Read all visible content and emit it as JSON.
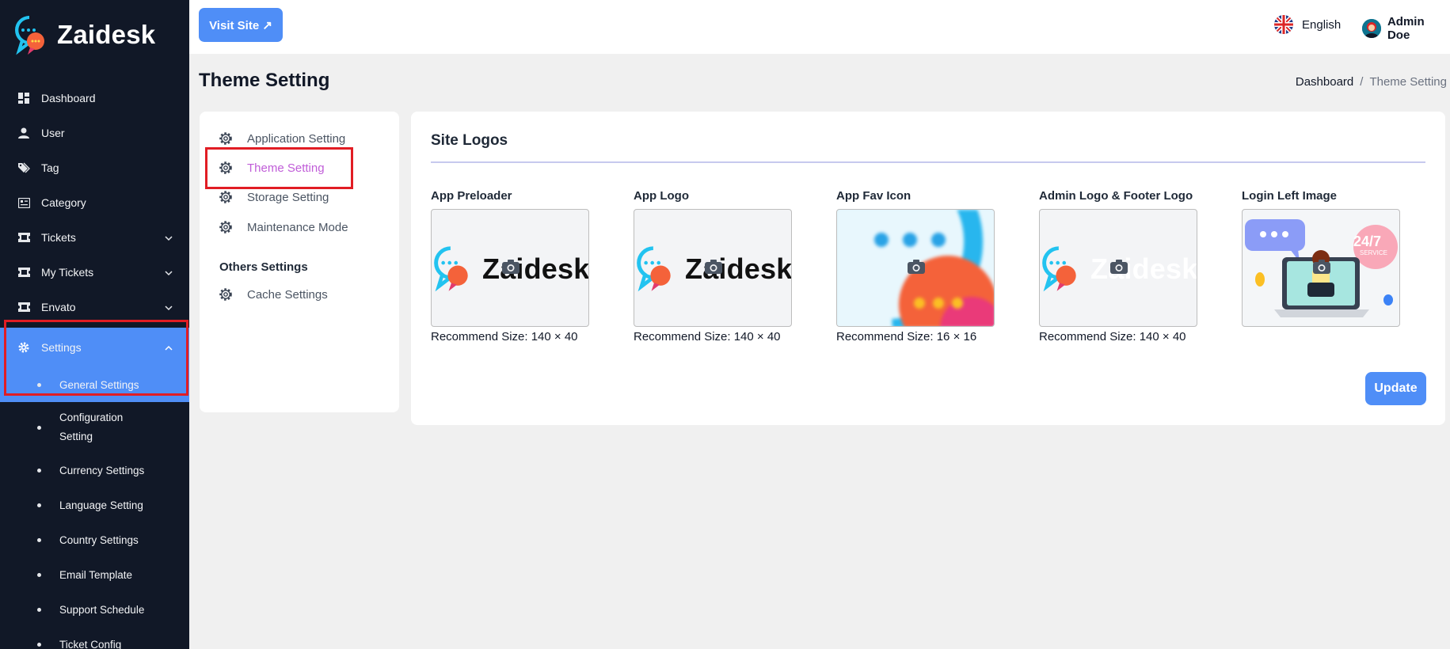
{
  "brand": {
    "name": "Zaidesk"
  },
  "sidebar": {
    "items": [
      {
        "label": "Dashboard",
        "icon": "dashboard-icon"
      },
      {
        "label": "User",
        "icon": "user-icon"
      },
      {
        "label": "Tag",
        "icon": "tag-icon"
      },
      {
        "label": "Category",
        "icon": "category-icon"
      },
      {
        "label": "Tickets",
        "icon": "ticket-icon",
        "has_chevron": true
      },
      {
        "label": "My Tickets",
        "icon": "ticket-icon",
        "has_chevron": true
      },
      {
        "label": "Envato",
        "icon": "ticket-icon",
        "has_chevron": true
      },
      {
        "label": "Settings",
        "icon": "gear-icon",
        "expanded": true
      }
    ],
    "subitems": [
      {
        "label": "General Settings"
      },
      {
        "label": "Configuration Setting"
      },
      {
        "label": "Currency Settings"
      },
      {
        "label": "Language Setting"
      },
      {
        "label": "Country Settings"
      },
      {
        "label": "Email Template"
      },
      {
        "label": "Support Schedule"
      },
      {
        "label": "Ticket Config"
      }
    ]
  },
  "topbar": {
    "visit_label": "Visit Site ↗",
    "language": "English",
    "user_name": "Admin Doe"
  },
  "page": {
    "title": "Theme Setting",
    "breadcrumb": {
      "root": "Dashboard",
      "separator": "/",
      "current": "Theme Setting"
    }
  },
  "settings_menu": {
    "items": [
      {
        "label": "Application Setting"
      },
      {
        "label": "Theme Setting"
      },
      {
        "label": "Storage Setting"
      },
      {
        "label": "Maintenance Mode"
      }
    ],
    "others_heading": "Others Settings",
    "others_items": [
      {
        "label": "Cache Settings"
      }
    ]
  },
  "site_logos": {
    "title": "Site Logos",
    "logos": [
      {
        "label": "App Preloader",
        "recommend": "Recommend Size: 140 × 40",
        "preview_text": "Zaidesk"
      },
      {
        "label": "App Logo",
        "recommend": "Recommend Size: 140 × 40",
        "preview_text": "Zaidesk"
      },
      {
        "label": "App Fav Icon",
        "recommend": "Recommend Size: 16 × 16"
      },
      {
        "label": "Admin Logo & Footer Logo",
        "recommend": "Recommend Size: 140 × 40",
        "preview_text": "Zaidesk"
      },
      {
        "label": "Login Left Image",
        "badge_main": "24/7",
        "badge_sub": "SERVICE"
      }
    ],
    "update_label": "Update"
  },
  "colors": {
    "sidebar_bg": "#111827",
    "accent": "#4f8ef7",
    "active_menu": "#c05dd8",
    "highlight": "#e11d24"
  }
}
